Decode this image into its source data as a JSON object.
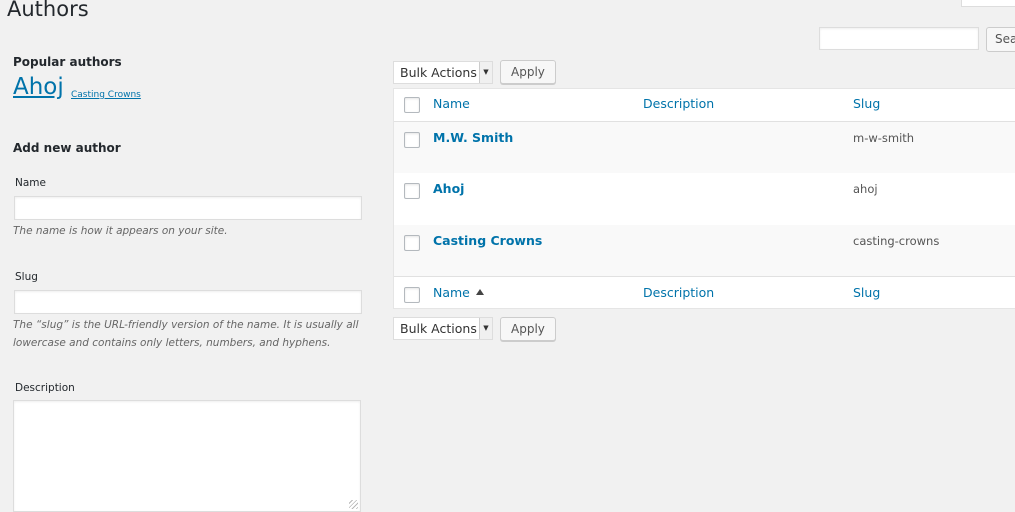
{
  "page": {
    "title": "Authors"
  },
  "search": {
    "button_label": "Sea",
    "value": ""
  },
  "popular": {
    "heading": "Popular authors",
    "tags": [
      {
        "label": "Ahoj"
      },
      {
        "label": "Casting Crowns"
      }
    ]
  },
  "add_form": {
    "heading": "Add new author",
    "name_label": "Name",
    "name_hint": "The name is how it appears on your site.",
    "slug_label": "Slug",
    "slug_hint": "The “slug” is the URL-friendly version of the name. It is usually all lowercase and contains only letters, numbers, and hyphens.",
    "description_label": "Description"
  },
  "bulk": {
    "selected": "Bulk Actions",
    "apply_label": "Apply"
  },
  "table": {
    "columns": {
      "name": "Name",
      "description": "Description",
      "slug": "Slug"
    },
    "rows": [
      {
        "name": "M.W. Smith",
        "description": "",
        "slug": "m-w-smith"
      },
      {
        "name": "Ahoj",
        "description": "",
        "slug": "ahoj"
      },
      {
        "name": "Casting Crowns",
        "description": "",
        "slug": "casting-crowns"
      }
    ],
    "footer_sort": "ascending"
  },
  "colors": {
    "link": "#0073aa",
    "background": "#f1f1f1",
    "row_alt": "#f9f9f9"
  }
}
